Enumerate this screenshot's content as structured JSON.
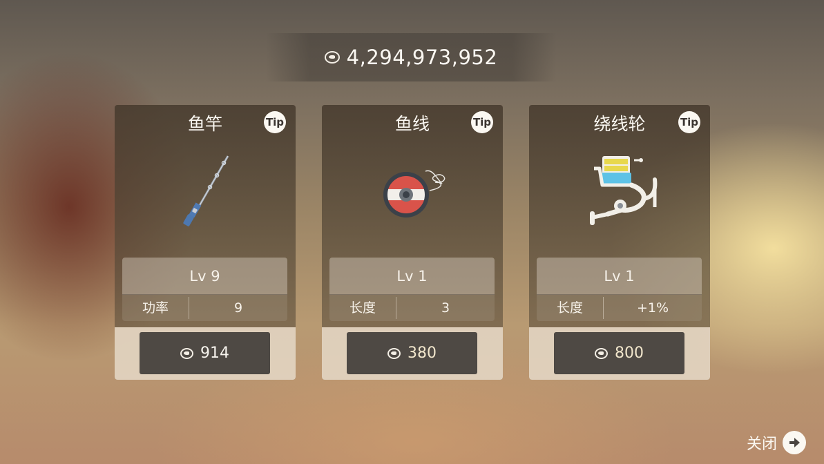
{
  "header": {
    "balance": "4,294,973,952",
    "currency_icon": "fish-coin-icon"
  },
  "cards": [
    {
      "title": "鱼竿",
      "tip": "Tip",
      "icon": "fishing-rod-icon",
      "level": "Lv 9",
      "stat_label": "功率",
      "stat_value": "9",
      "price": "914"
    },
    {
      "title": "鱼线",
      "tip": "Tip",
      "icon": "fishing-line-spool-icon",
      "level": "Lv 1",
      "stat_label": "长度",
      "stat_value": "3",
      "price": "380"
    },
    {
      "title": "绕线轮",
      "tip": "Tip",
      "icon": "fishing-reel-icon",
      "level": "Lv 1",
      "stat_label": "长度",
      "stat_value": "+1%",
      "price": "800"
    }
  ],
  "footer": {
    "close_label": "关闭",
    "close_icon": "arrow-right-icon"
  },
  "colors": {
    "button_bg": "#4e4944",
    "card_foot_bg": "#e6d7c3",
    "price_gold": "#f1e6cc"
  }
}
